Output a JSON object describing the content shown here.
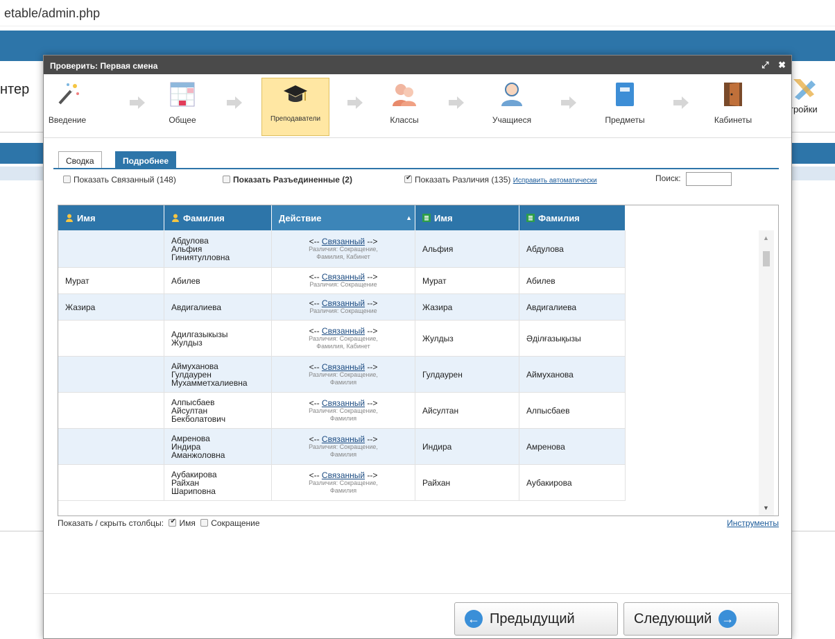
{
  "browser": {
    "url_fragment": "etable/admin.php"
  },
  "background": {
    "menu_left": "нтер",
    "menu_right": "тройки"
  },
  "dialog": {
    "title": "Проверить: Первая смена",
    "controls": [
      "⤢",
      "✖"
    ]
  },
  "steps": [
    {
      "label": "Введение",
      "icon": "magic-wand-icon"
    },
    {
      "label": "Общее",
      "icon": "calendar-grid-icon"
    },
    {
      "label": "Преподаватели",
      "icon": "graduation-cap-icon",
      "active": true
    },
    {
      "label": "Классы",
      "icon": "group-people-icon"
    },
    {
      "label": "Учащиеся",
      "icon": "student-icon"
    },
    {
      "label": "Предметы",
      "icon": "book-icon"
    },
    {
      "label": "Кабинеты",
      "icon": "door-icon"
    }
  ],
  "tabs": {
    "summary": "Сводка",
    "details": "Подробнее"
  },
  "filters": {
    "show_linked": "Показать Связанный (148)",
    "show_unlinked": "Показать Разъединенные (2)",
    "show_diff": "Показать Различия (135)",
    "fix_auto": "Исправить автоматически",
    "search_label": "Поиск:",
    "search_value": ""
  },
  "grid": {
    "headers": [
      "Имя",
      "Фамилия",
      "Действие",
      "Имя",
      "Фамилия"
    ],
    "link_prefix": "<-- ",
    "link_text": "Связанный",
    "link_suffix": " -->",
    "rows": [
      {
        "first": "",
        "last": [
          "Абдулова",
          "Альфия",
          "Гиниятулловна"
        ],
        "diff": [
          "Различия: Сокращение,",
          "Фамилия, Кабинет"
        ],
        "first2": "Альфия",
        "last2": "Абдулова"
      },
      {
        "first": "Мурат",
        "last": [
          "Абилев"
        ],
        "diff": [
          "Различия: Сокращение"
        ],
        "first2": "Мурат",
        "last2": "Абилев"
      },
      {
        "first": "Жазира",
        "last": [
          "Авдигалиева"
        ],
        "diff": [
          "Различия: Сокращение"
        ],
        "first2": "Жазира",
        "last2": "Авдигалиева"
      },
      {
        "first": "",
        "last": [
          "Адилгазыкызы",
          "Жулдыз"
        ],
        "diff": [
          "Различия: Сокращение,",
          "Фамилия, Кабинет"
        ],
        "first2": "Жулдыз",
        "last2": "Әділғазықызы"
      },
      {
        "first": "",
        "last": [
          "Аймуханова",
          "Гулдаурен",
          "Мухамметхалиевна"
        ],
        "diff": [
          "Различия: Сокращение,",
          "Фамилия"
        ],
        "first2": "Гулдаурен",
        "last2": "Аймуханова"
      },
      {
        "first": "",
        "last": [
          "Алпысбаев",
          "Айсултан",
          "Бекболатович"
        ],
        "diff": [
          "Различия: Сокращение,",
          "Фамилия"
        ],
        "first2": "Айсултан",
        "last2": "Алпысбаев"
      },
      {
        "first": "",
        "last": [
          "Амренова",
          "Индира",
          "Аманжоловна"
        ],
        "diff": [
          "Различия: Сокращение,",
          "Фамилия"
        ],
        "first2": "Индира",
        "last2": "Амренова"
      },
      {
        "first": "",
        "last": [
          "Аубакирова",
          "Райхан",
          "Шариповна"
        ],
        "diff": [
          "Различия: Сокращение,",
          "Фамилия"
        ],
        "first2": "Райхан",
        "last2": "Аубакирова"
      }
    ]
  },
  "footer": {
    "columns_label": "Показать / скрыть столбцы:",
    "col_name": "Имя",
    "col_short": "Сокращение",
    "tools": "Инструменты"
  },
  "buttons": {
    "prev": "Предыдущий",
    "next": "Следующий"
  },
  "colors": {
    "accent": "#2d75a9",
    "row_alt": "#e8f1fa",
    "active_step": "#ffe7a3"
  }
}
